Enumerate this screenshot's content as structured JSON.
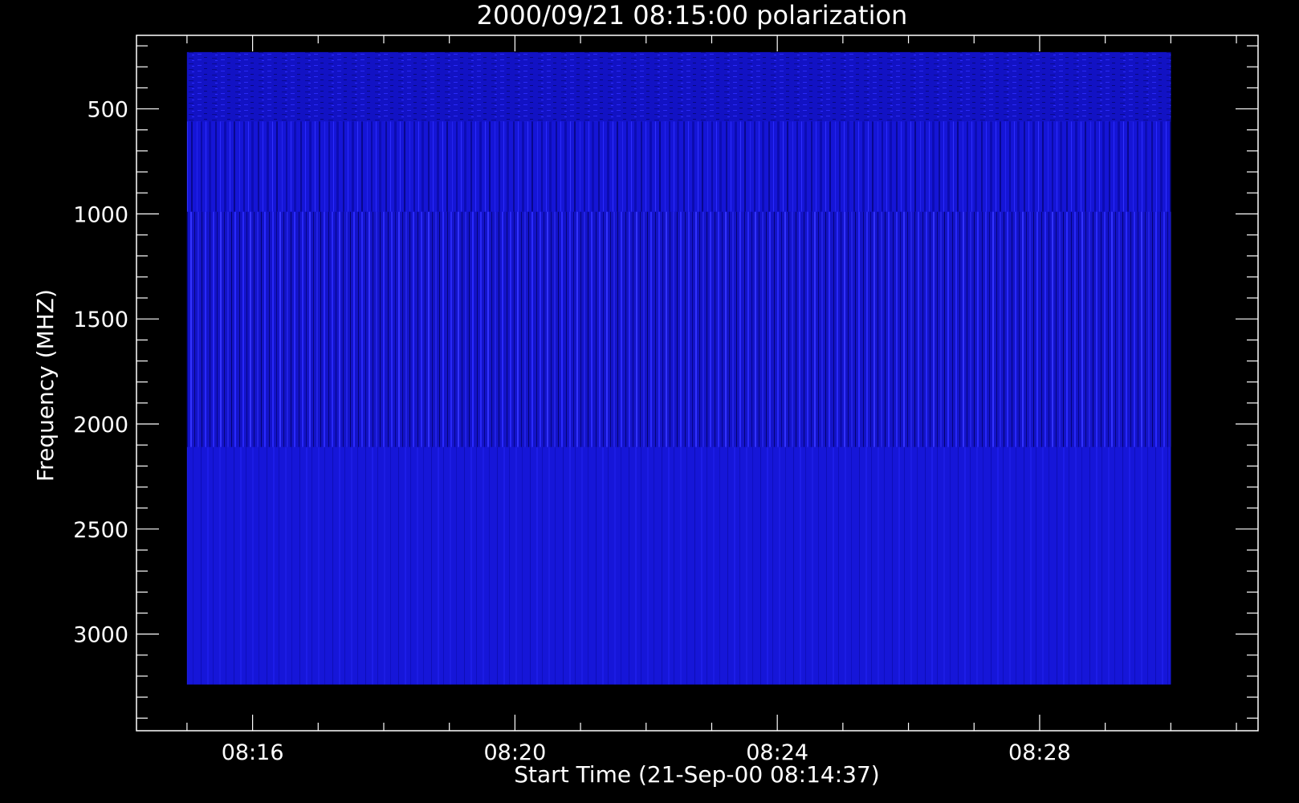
{
  "chart_data": {
    "type": "heatmap",
    "title": "2000/09/21 08:15:00 polarization",
    "xlabel": "Start Time (21-Sep-00 08:14:37)",
    "ylabel": "Frequency (MHZ)",
    "x_ticks": [
      "08:16",
      "08:20",
      "08:24",
      "08:28"
    ],
    "x_tick_values_min": [
      16,
      20,
      24,
      28
    ],
    "xlim_min": [
      14.23,
      31.33
    ],
    "data_x_range_min": [
      15.0,
      30.0
    ],
    "y_ticks": [
      500,
      1000,
      1500,
      2000,
      2500,
      3000
    ],
    "ylim": [
      3460,
      150
    ],
    "data_y_range": [
      230,
      3240
    ],
    "y_minor_step": 100,
    "x_minor_step_min": 1,
    "band_breaks_mhz": [
      560,
      990,
      2110
    ],
    "fill_color": "#1414d2",
    "background_color": "#000000",
    "axis_color": "#ffffff",
    "grid": false,
    "legend": "none"
  }
}
